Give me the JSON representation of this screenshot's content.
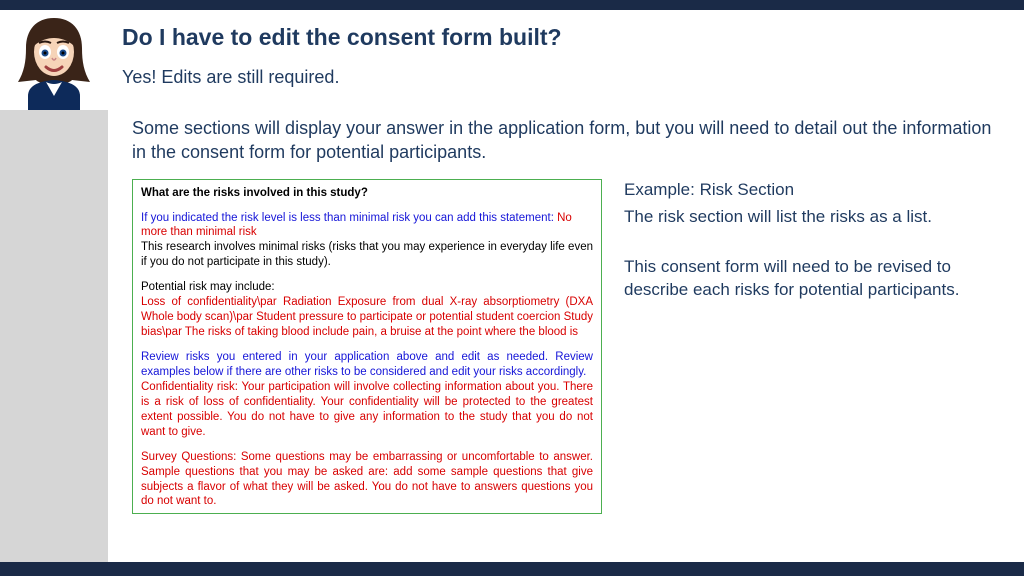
{
  "title": "Do I have to edit the consent form built?",
  "subtitle": "Yes!  Edits are still required.",
  "intro": "Some sections will display your answer in the application form, but you will need to detail out the information in the consent form for potential participants.",
  "example": {
    "heading": "What are the risks involved in this study?",
    "blue1_prefix": "If you indicated the risk level is less than minimal risk you can add this statement: ",
    "red_inline": "No more than minimal risk",
    "black1": "This research involves minimal risks (risks that you may experience in everyday life even if you do not participate in this study).",
    "black2": "Potential risk may include:",
    "red1": "Loss of confidentiality\\par Radiation Exposure from dual X-ray absorptiometry (DXA Whole body scan)\\par Student pressure to participate or potential student coercion Study bias\\par The risks of taking blood include pain, a bruise at the point where the blood is",
    "blue2": "Review risks you entered in your application above and edit as needed. Review examples below if there are other risks to be considered and edit your risks accordingly.",
    "red2": "Confidentiality risk: Your participation will involve collecting information about you. There is a risk of loss of confidentiality.  Your confidentiality will be protected to the greatest extent possible. You do not have to give any information to the study that you do not want to give.",
    "red3": "Survey Questions: Some questions may be embarrassing or uncomfortable to answer. Sample questions that you may be asked are: add some sample questions that give subjects a flavor of what they will be asked. You do not have to answers questions you do not want to."
  },
  "notes": {
    "n1": "Example: Risk Section",
    "n2": "The risk section will list the risks as a list.",
    "n3": "This consent form will need to be revised to describe each risks for potential participants."
  }
}
